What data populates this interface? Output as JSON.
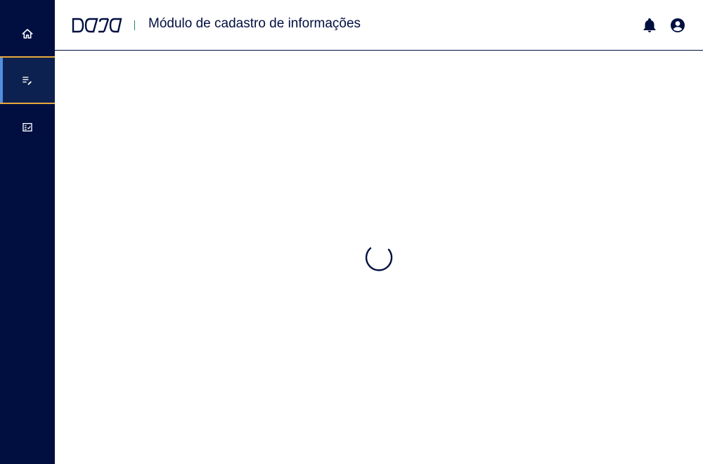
{
  "sidebar": {
    "items": [
      {
        "name": "home",
        "icon": "home-icon"
      },
      {
        "name": "register",
        "icon": "edit-list-icon",
        "active": true
      },
      {
        "name": "checklist",
        "icon": "checklist-icon"
      }
    ]
  },
  "header": {
    "logo_text": "DASA",
    "separator": "|",
    "title": "Módulo de cadastro de informações",
    "icons": [
      "bell-icon",
      "account-circle-icon"
    ]
  },
  "main": {
    "state": "loading",
    "loader_icon": "loading-spinner-icon"
  },
  "colors": {
    "sidebar_bg": "#000f40",
    "active_item_bg": "#0d2150",
    "active_item_border": "#e7a73a",
    "active_item_bar": "#4f8fe0",
    "brand_navy": "#000f40",
    "separator": "#1a8a6a"
  }
}
